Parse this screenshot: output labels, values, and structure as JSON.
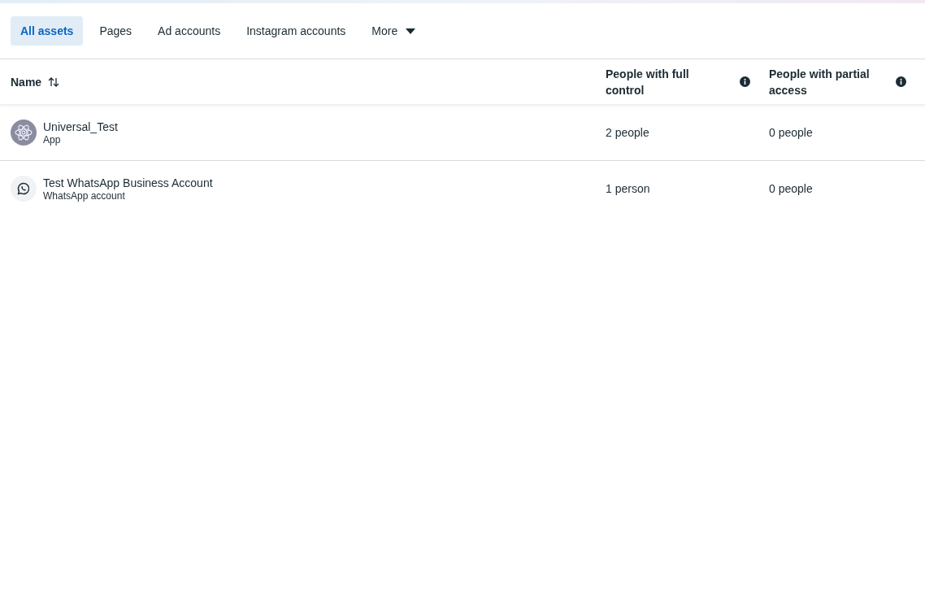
{
  "tabs": [
    {
      "label": "All assets",
      "selected": true
    },
    {
      "label": "Pages",
      "selected": false
    },
    {
      "label": "Ad accounts",
      "selected": false
    },
    {
      "label": "Instagram accounts",
      "selected": false
    },
    {
      "label": "More",
      "selected": false,
      "kind": "dropdown"
    }
  ],
  "table": {
    "columns": [
      {
        "label": "Name",
        "kind": "sortable"
      },
      {
        "label": "People with full control",
        "kind": "info"
      },
      {
        "label": "People with partial access",
        "kind": "info"
      }
    ],
    "rows": [
      {
        "name": "Universal_Test",
        "type": "App",
        "kind": "app",
        "full_control": "2 people",
        "partial_access": "0 people"
      },
      {
        "name": "Test WhatsApp Business Account",
        "type": "WhatsApp account",
        "kind": "whatsapp",
        "full_control": "1 person",
        "partial_access": "0 people"
      }
    ]
  }
}
